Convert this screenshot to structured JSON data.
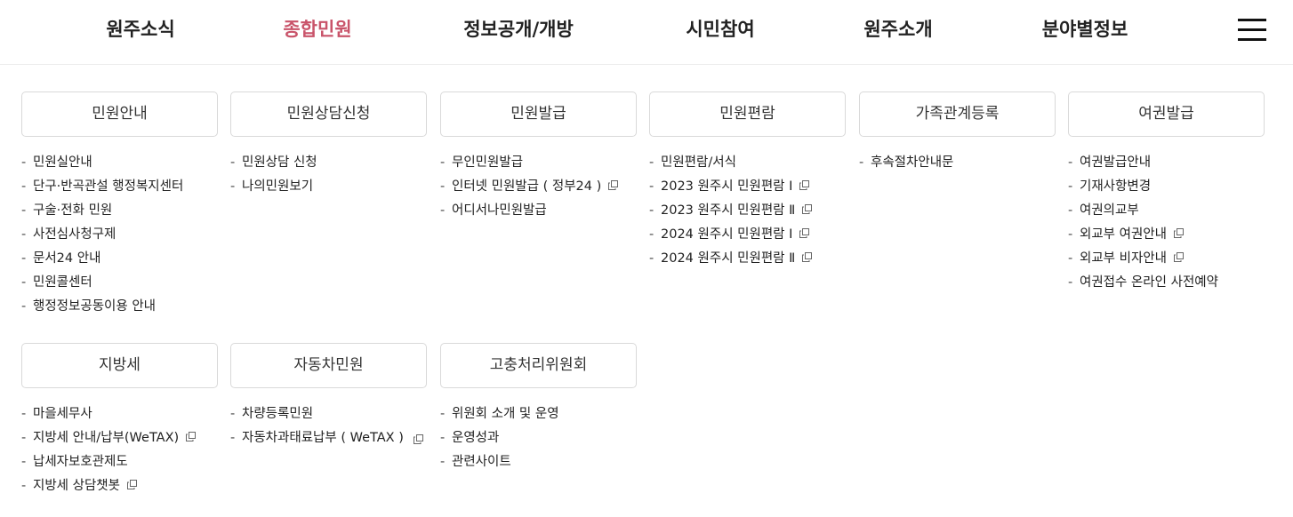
{
  "nav": {
    "items": [
      "원주소식",
      "종합민원",
      "정보공개/개방",
      "시민참여",
      "원주소개",
      "분야별정보"
    ],
    "active": "종합민원",
    "active_color": "#c9546a"
  },
  "menu": [
    {
      "title": "민원안내",
      "links": [
        {
          "label": "민원실안내",
          "external": false
        },
        {
          "label": "단구·반곡관설 행정복지센터",
          "external": false
        },
        {
          "label": "구술·전화 민원",
          "external": false
        },
        {
          "label": "사전심사청구제",
          "external": false
        },
        {
          "label": "문서24 안내",
          "external": false
        },
        {
          "label": "민원콜센터",
          "external": false
        },
        {
          "label": "행정정보공동이용 안내",
          "external": false
        }
      ]
    },
    {
      "title": "민원상담신청",
      "links": [
        {
          "label": "민원상담 신청",
          "external": false
        },
        {
          "label": "나의민원보기",
          "external": false
        }
      ]
    },
    {
      "title": "민원발급",
      "links": [
        {
          "label": "무인민원발급",
          "external": false
        },
        {
          "label": "인터넷 민원발급 ( 정부24 )",
          "external": true
        },
        {
          "label": "어디서나민원발급",
          "external": false
        }
      ]
    },
    {
      "title": "민원편람",
      "links": [
        {
          "label": "민원편람/서식",
          "external": false
        },
        {
          "label": "2023 원주시 민원편람 Ⅰ",
          "external": true
        },
        {
          "label": "2023 원주시 민원편람 Ⅱ",
          "external": true
        },
        {
          "label": "2024 원주시 민원편람 Ⅰ",
          "external": true
        },
        {
          "label": "2024 원주시 민원편람 Ⅱ",
          "external": true
        }
      ]
    },
    {
      "title": "가족관계등록",
      "links": [
        {
          "label": "후속절차안내문",
          "external": false
        }
      ]
    },
    {
      "title": "여권발급",
      "links": [
        {
          "label": "여권발급안내",
          "external": false
        },
        {
          "label": "기재사항변경",
          "external": false
        },
        {
          "label": "여권의교부",
          "external": false
        },
        {
          "label": "외교부 여권안내",
          "external": true
        },
        {
          "label": "외교부 비자안내",
          "external": true
        },
        {
          "label": "여권접수 온라인 사전예약",
          "external": false
        }
      ]
    },
    {
      "title": "지방세",
      "links": [
        {
          "label": "마을세무사",
          "external": false
        },
        {
          "label": "지방세 안내/납부(WeTAX)",
          "external": true
        },
        {
          "label": "납세자보호관제도",
          "external": false
        },
        {
          "label": "지방세 상담챗봇",
          "external": true
        }
      ]
    },
    {
      "title": "자동차민원",
      "links": [
        {
          "label": "차량등록민원",
          "external": false
        },
        {
          "label": "자동차과태료납부 ( WeTAX )",
          "external": true,
          "wrap": true
        }
      ]
    },
    {
      "title": "고충처리위원회",
      "links": [
        {
          "label": "위원회 소개 및 운영",
          "external": false
        },
        {
          "label": "운영성과",
          "external": false
        },
        {
          "label": "관련사이트",
          "external": false
        }
      ]
    }
  ],
  "icons": {
    "external_link": "external-link-icon",
    "menu": "hamburger-menu-icon"
  }
}
